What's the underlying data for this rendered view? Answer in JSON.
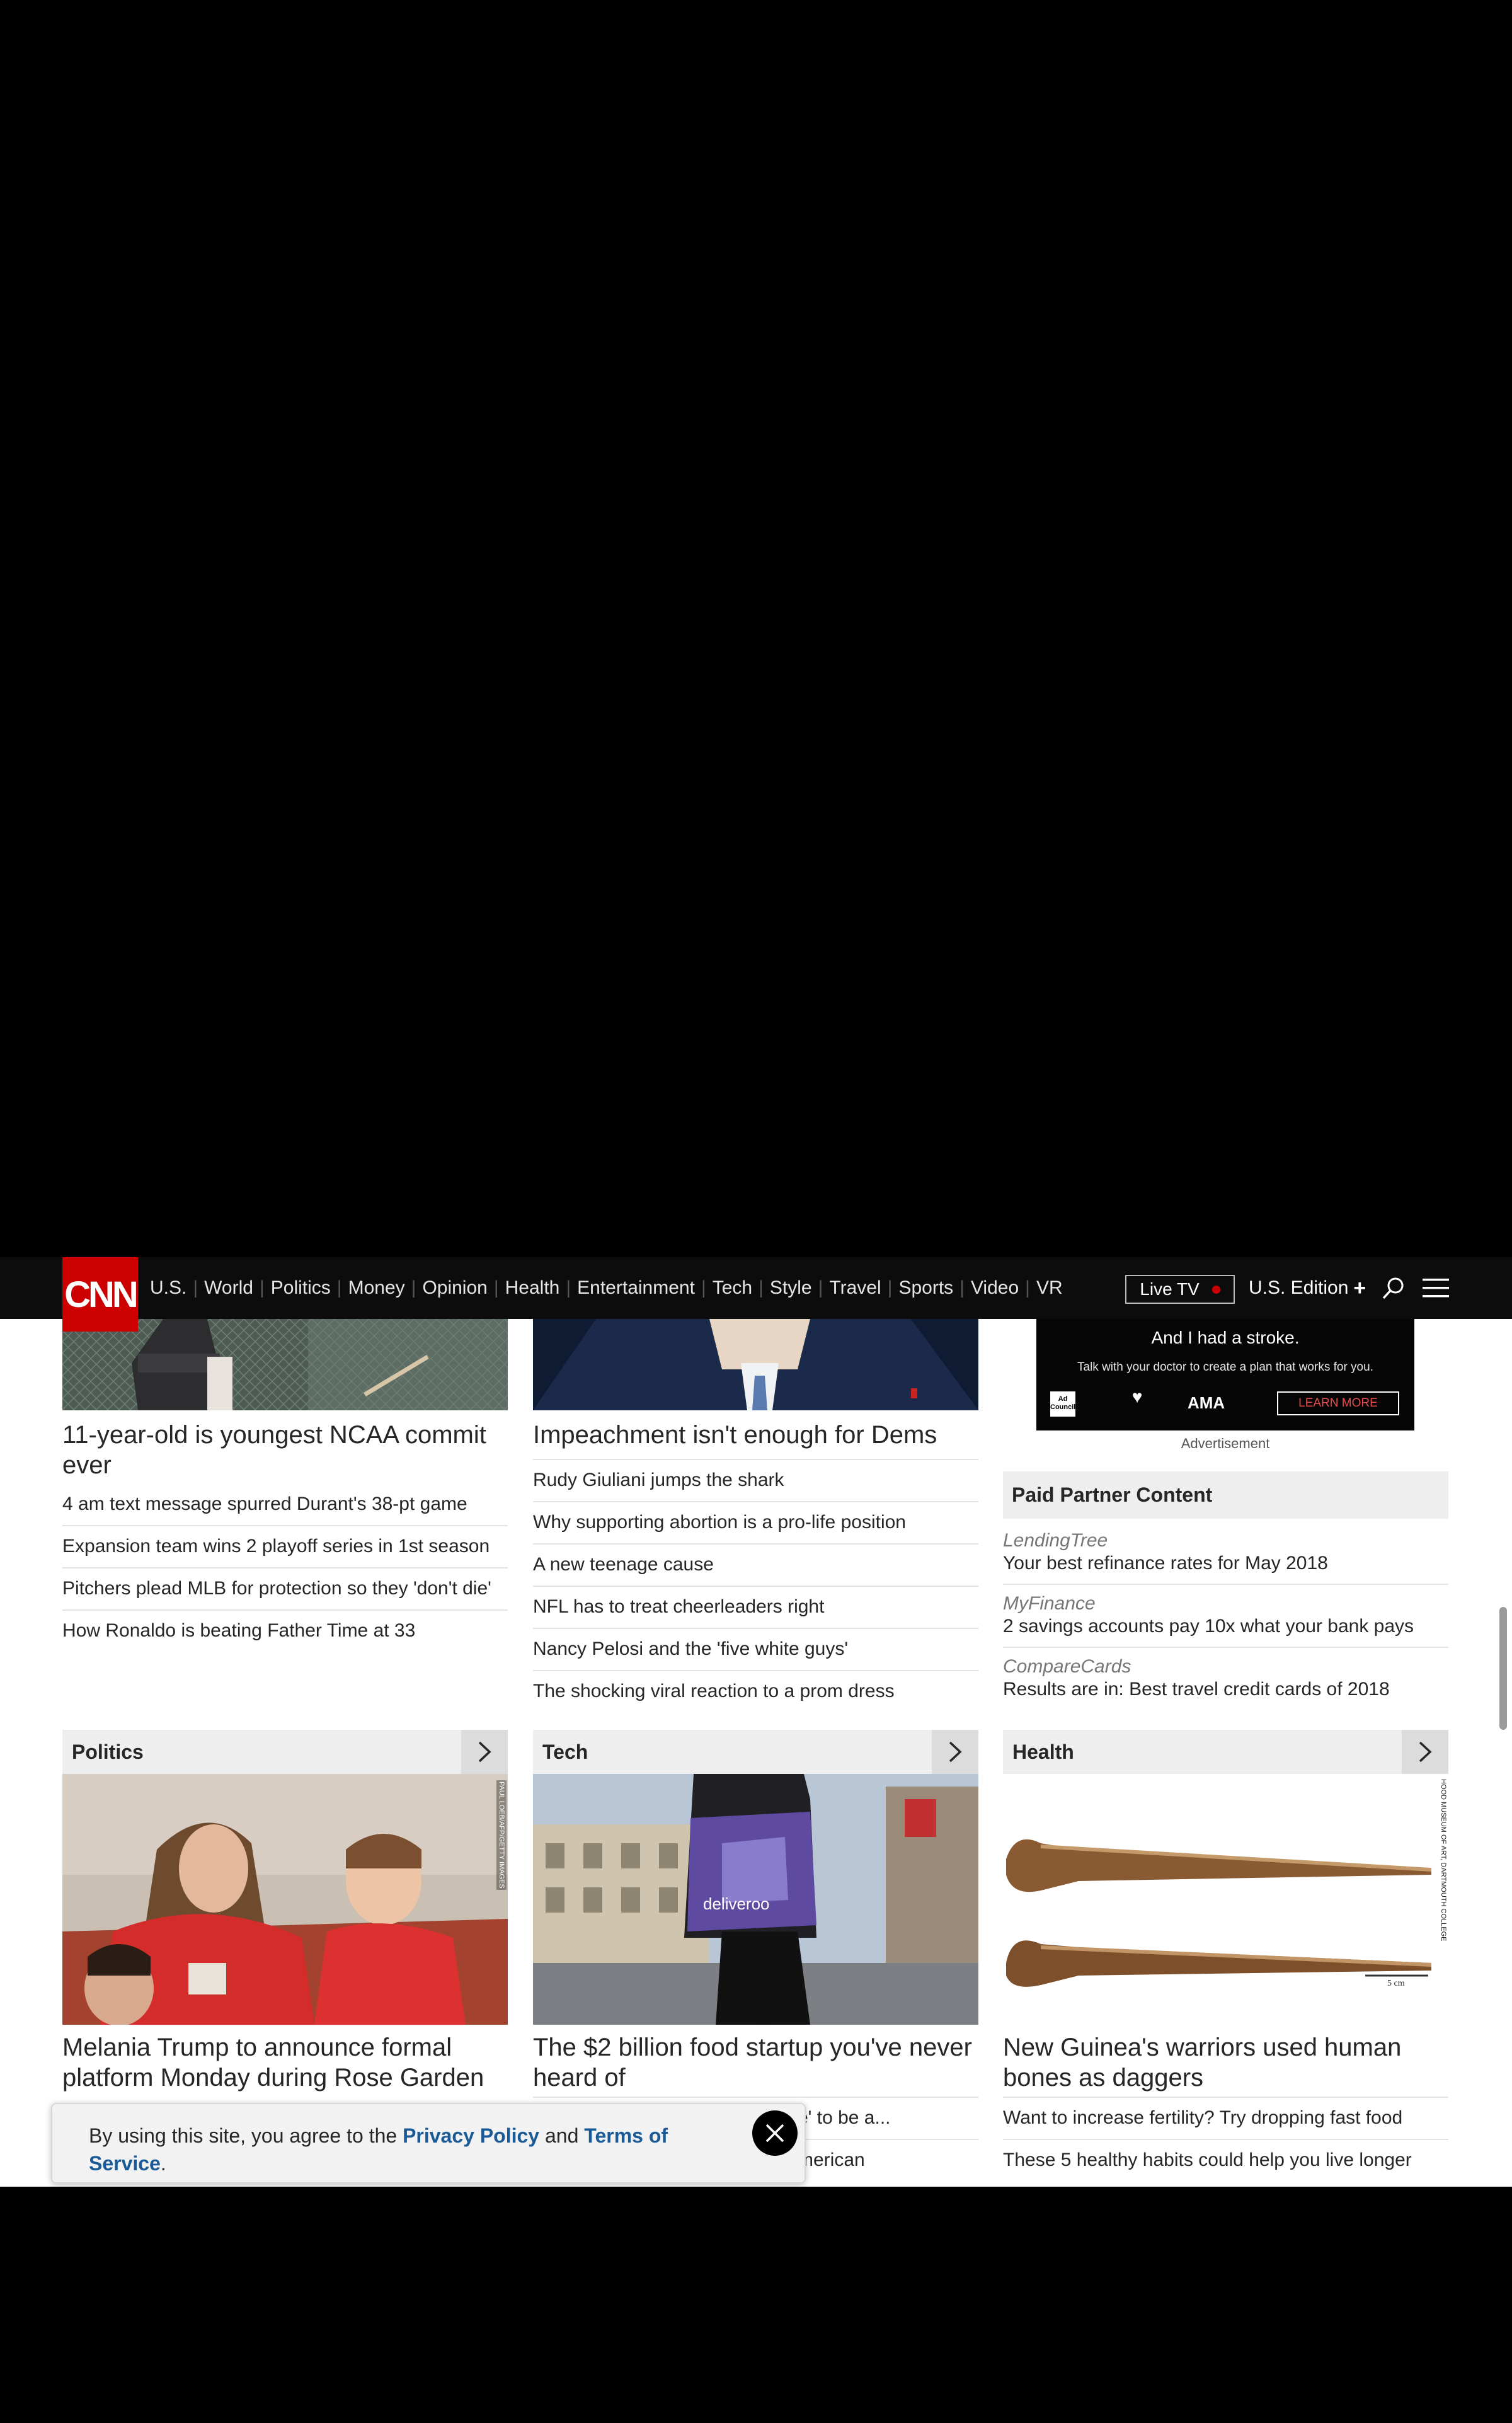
{
  "nav": {
    "logo": "CNN",
    "links": [
      "U.S.",
      "World",
      "Politics",
      "Money",
      "Opinion",
      "Health",
      "Entertainment",
      "Tech",
      "Style",
      "Travel",
      "Sports",
      "Video",
      "VR"
    ],
    "live_tv": "Live TV",
    "edition": "U.S. Edition",
    "edition_plus": "+"
  },
  "sports": {
    "headline": "11-year-old is youngest NCAA commit ever",
    "stories": [
      "4 am text message spurred Durant's 38-pt game",
      "Expansion team wins 2 playoff series in 1st season",
      "Pitchers plead MLB for protection so they 'don't die'",
      "How Ronaldo is beating Father Time at 33"
    ]
  },
  "opinion": {
    "headline": "Impeachment isn't enough for Dems",
    "stories": [
      "Rudy Giuliani jumps the shark",
      "Why supporting abortion is a pro-life position",
      "A new teenage cause",
      "NFL has to treat cheerleaders right",
      "Nancy Pelosi and the 'five white guys'",
      "The shocking viral reaction to a prom dress"
    ]
  },
  "ad": {
    "headline": "And I had a stroke.",
    "subline": "Talk with your doctor to create a plan that works for you.",
    "cta": "LEARN MORE",
    "badge": "Ad Council",
    "brand": "AMA",
    "label": "Advertisement"
  },
  "paid": {
    "heading": "Paid Partner Content",
    "items": [
      {
        "source": "LendingTree",
        "title": "Your best refinance rates for May 2018"
      },
      {
        "source": "MyFinance",
        "title": "2 savings accounts pay 10x what your bank pays"
      },
      {
        "source": "CompareCards",
        "title": "Results are in: Best travel credit cards of 2018"
      }
    ]
  },
  "politics": {
    "label": "Politics",
    "credit": "PAUL LOEB/AFP/GETTY IMAGES",
    "headline": "Melania Trump to announce formal platform Monday during Rose Garden"
  },
  "tech": {
    "label": "Tech",
    "bag_text": "deliveroo",
    "headline": "The $2 billion food startup you've never heard of",
    "stories": [
      "e' to be a...",
      "merican"
    ]
  },
  "health": {
    "label": "Health",
    "credit": "HOOD MUSEUM OF ART, DARTMOUTH COLLEGE",
    "scale": "5 cm",
    "headline": "New Guinea's warriors used human bones as daggers",
    "stories": [
      "Want to increase fertility? Try dropping fast food",
      "These 5 healthy habits could help you live longer"
    ]
  },
  "cookie": {
    "prefix": "By using this site, you agree to the ",
    "privacy": "Privacy Policy",
    "and": " and ",
    "terms": "Terms of Service",
    "suffix": "."
  }
}
